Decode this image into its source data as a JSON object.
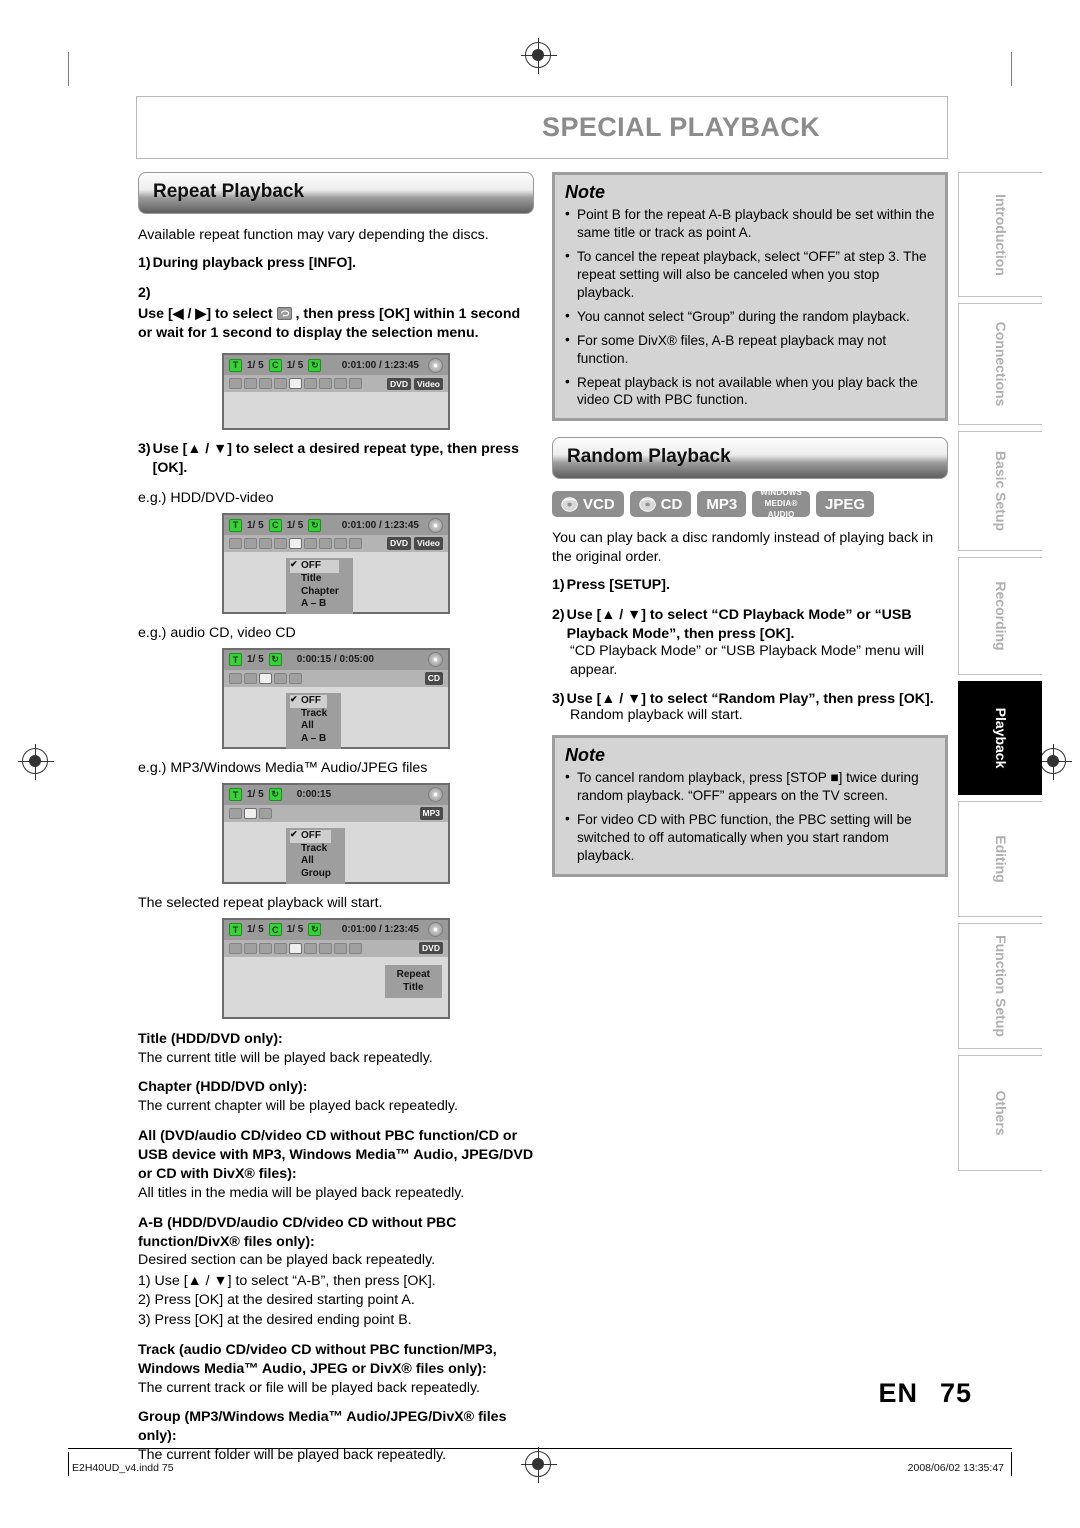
{
  "header": {
    "title": "SPECIAL PLAYBACK"
  },
  "left": {
    "section_title": "Repeat Playback",
    "intro": "Available repeat function may vary depending the discs.",
    "step1_n": "1)",
    "step1_t": "During playback press [INFO].",
    "step2_n": "2)",
    "step2_a": "Use [◀ / ▶] to select",
    "step2_b": ", then press [OK] within 1 second or wait for 1 second to display the selection menu.",
    "step3_n": "3)",
    "step3_t": "Use [▲ / ▼] to select a desired repeat type, then press [OK].",
    "eg1": "e.g.) HDD/DVD-video",
    "eg2": "e.g.) audio CD, video CD",
    "eg3": "e.g.) MP3/Windows Media™ Audio/JPEG files",
    "result": "The selected repeat playback will start.",
    "types": [
      {
        "head": "Title (HDD/DVD only):",
        "body": "The current title will be played back repeatedly."
      },
      {
        "head": "Chapter (HDD/DVD only):",
        "body": "The current chapter will be played back repeatedly."
      },
      {
        "head": "All (DVD/audio CD/video CD without PBC function/CD or USB device with MP3, Windows Media™ Audio, JPEG/DVD or CD with DivX® files):",
        "body": "All titles in the media will be played back repeatedly."
      },
      {
        "head": "A-B (HDD/DVD/audio CD/video CD without PBC function/DivX® files only):",
        "body": "Desired section can be played back repeatedly."
      },
      {
        "head": "Track (audio CD/video CD without PBC function/MP3, Windows Media™ Audio, JPEG or DivX® files only):",
        "body": "The current track or file will be played back repeatedly."
      },
      {
        "head": "Group (MP3/Windows Media™ Audio/JPEG/DivX® files only):",
        "body": "The current folder will be played back repeatedly."
      }
    ],
    "ab_steps": [
      "1) Use [▲ / ▼] to select “A-B”, then press [OK].",
      "2) Press [OK] at the desired starting point A.",
      "3) Press [OK] at the desired ending point B."
    ]
  },
  "osd": {
    "hdd_dvd": {
      "t_label": "T",
      "t_count": "1/ 5",
      "c_label": "C",
      "c_count": "1/ 5",
      "time": "0:01:00 / 1:23:45",
      "formats": [
        "DVD",
        "Video"
      ]
    },
    "hdd_dvd_menu": [
      "OFF",
      "Title",
      "Chapter",
      "A – B"
    ],
    "cd": {
      "t_label": "T",
      "t_count": "1/  5",
      "time": "0:00:15 / 0:05:00",
      "formats": [
        "CD"
      ]
    },
    "cd_menu": [
      "OFF",
      "Track",
      "All",
      "A – B"
    ],
    "mp3": {
      "t_label": "T",
      "t_count": "1/  5",
      "time": "0:00:15",
      "formats": [
        "MP3"
      ]
    },
    "mp3_menu": [
      "OFF",
      "Track",
      "All",
      "Group"
    ],
    "result": {
      "t_label": "T",
      "t_count": "1/ 5",
      "c_label": "C",
      "c_count": "1/ 5",
      "time": "0:01:00 / 1:23:45",
      "formats": [
        "DVD"
      ],
      "overlay_line1": "Repeat",
      "overlay_line2": "Title"
    }
  },
  "note1": {
    "title": "Note",
    "items": [
      "Point B for the repeat A-B playback should be set within the same title or track as point A.",
      "To cancel the repeat playback, select “OFF” at step 3. The repeat setting will also be canceled when you stop playback.",
      "You cannot select “Group” during the random playback.",
      "For some DivX® files, A-B repeat playback may not function.",
      "Repeat playback is not available when you play back the video CD with PBC function."
    ]
  },
  "right": {
    "section_title": "Random Playback",
    "badges": [
      "VCD",
      "CD",
      "MP3",
      "WINDOWS MEDIA® AUDIO",
      "JPEG"
    ],
    "badge_wm": {
      "l1": "WINDOWS",
      "l2": "MEDIA®",
      "l3": "AUDIO"
    },
    "intro": "You can play back a disc randomly instead of playing back in the original order.",
    "step1_n": "1)",
    "step1_t": "Press [SETUP].",
    "step2_n": "2)",
    "step2_t": "Use [▲ / ▼] to select “CD Playback Mode” or “USB Playback Mode”, then press [OK].",
    "step2_sub": "“CD Playback Mode” or “USB Playback Mode” menu will appear.",
    "step3_n": "3)",
    "step3_t": "Use [▲ / ▼] to select “Random Play”, then press [OK].",
    "step3_sub": "Random playback will start."
  },
  "note2": {
    "title": "Note",
    "items": [
      "To cancel random playback, press [STOP ■] twice during random playback. “OFF” appears on the TV screen.",
      "For video CD with PBC function, the PBC setting will be switched to off automatically when you start random playback."
    ]
  },
  "rail": {
    "tabs": [
      {
        "label": "Introduction",
        "active": false
      },
      {
        "label": "Connections",
        "active": false
      },
      {
        "label": "Basic Setup",
        "active": false
      },
      {
        "label": "Recording",
        "active": false
      },
      {
        "label": "Playback",
        "active": true
      },
      {
        "label": "Editing",
        "active": false
      },
      {
        "label": "Function Setup",
        "active": false
      },
      {
        "label": "Others",
        "active": false
      }
    ]
  },
  "footer": {
    "lang": "EN",
    "page": "75",
    "file": "E2H40UD_v4.indd  75",
    "stamp": "2008/06/02   13:35:47"
  }
}
